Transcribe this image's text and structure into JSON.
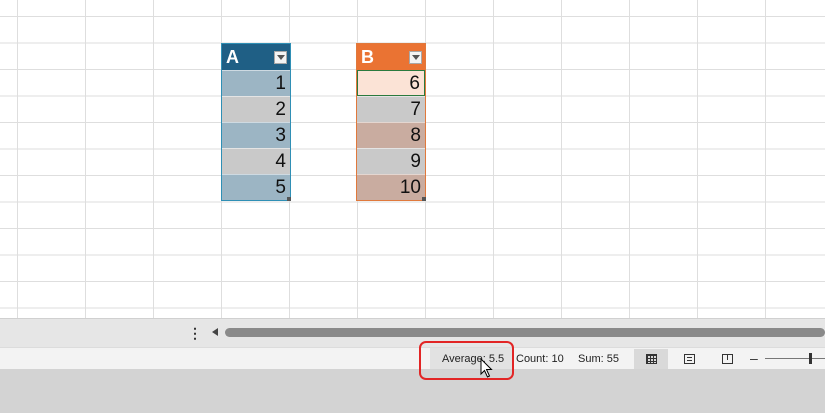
{
  "tables": [
    {
      "header": "A",
      "values": [
        "1",
        "2",
        "3",
        "4",
        "5"
      ]
    },
    {
      "header": "B",
      "values": [
        "6",
        "7",
        "8",
        "9",
        "10"
      ]
    }
  ],
  "sheet_bar": {
    "menu_label": "⋮"
  },
  "status_bar": {
    "average": "Average: 5.5",
    "count": "Count: 10",
    "sum": "Sum: 55",
    "zoom_minus": "–"
  },
  "colors": {
    "table_a_header": "#1f5f85",
    "table_b_header": "#ea7333",
    "highlight": "#e22525"
  },
  "icons": {
    "filter": "filter-dropdown-icon",
    "normal_view": "normal-view-icon",
    "page_layout": "page-layout-icon",
    "page_break": "page-break-preview-icon",
    "cursor": "mouse-pointer-icon"
  }
}
